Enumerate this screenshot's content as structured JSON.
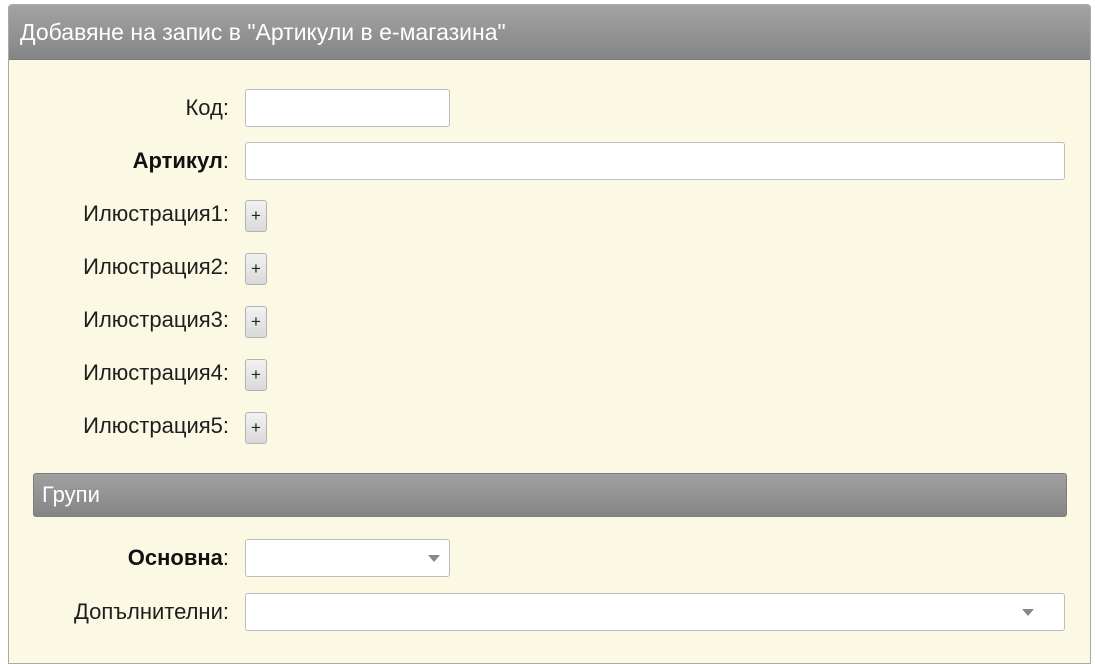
{
  "dialog": {
    "title": "Добавяне на запис в \"Артикули в е-магазина\""
  },
  "form": {
    "code": {
      "label": "Код",
      "value": ""
    },
    "article": {
      "label": "Артикул",
      "value": ""
    },
    "illustrations": [
      {
        "label": "Илюстрация1",
        "button": "+"
      },
      {
        "label": "Илюстрация2",
        "button": "+"
      },
      {
        "label": "Илюстрация3",
        "button": "+"
      },
      {
        "label": "Илюстрация4",
        "button": "+"
      },
      {
        "label": "Илюстрация5",
        "button": "+"
      }
    ],
    "colon": ":"
  },
  "groups": {
    "section_title": "Групи",
    "main": {
      "label": "Основна",
      "value": ""
    },
    "additional": {
      "label": "Допълнителни",
      "value": ""
    }
  },
  "icons": {
    "dropdown": "chevron-down-icon",
    "add": "plus-icon"
  }
}
